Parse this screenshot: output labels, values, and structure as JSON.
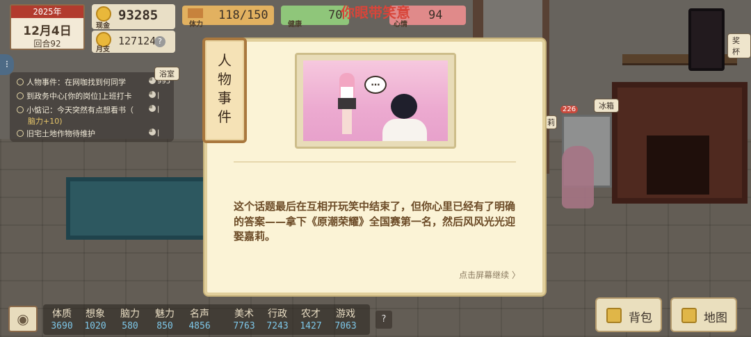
{
  "hud": {
    "year": "2025年",
    "date": "12月4日",
    "turn": "回合92",
    "cash_label": "现金",
    "cash_value": "93285",
    "salary_label": "月支",
    "salary_value": "127124",
    "stamina_label": "体力",
    "stamina_value": "118/150",
    "health_label": "健康",
    "health_value": "70",
    "mood_label": "心情",
    "mood_value": "94",
    "title": "你眼带笑意",
    "qmark": "?"
  },
  "tasks": [
    {
      "text": "人物事件：在网咖找到何同学",
      "progress": "995"
    },
    {
      "text": "到政务中心[你的岗位]上班打卡",
      "progress": "|"
    },
    {
      "text": "小惦记：今天突然有点想看书（",
      "progress": "|"
    },
    {
      "text": "旧宅土地作物待维护",
      "progress": "|"
    }
  ],
  "task_sub": "脑力+10)",
  "room_labels": {
    "bathroom": "浴室",
    "fridge": "冰箱",
    "trophy": "奖杯",
    "partial": "莉",
    "badge": "226"
  },
  "dialog": {
    "tag": "人物事件",
    "story": "这个话题最后在互相开玩笑中结束了，但你心里已经有了明确的答案——拿下《原潮荣耀》全国赛第一名，然后风风光光迎娶嘉莉。",
    "continue": "点击屏幕继续 〉",
    "bubble": "…"
  },
  "stats": [
    {
      "name": "体质",
      "value": "3690"
    },
    {
      "name": "想象",
      "value": "1020"
    },
    {
      "name": "脑力",
      "value": "580"
    },
    {
      "name": "魅力",
      "value": "850"
    },
    {
      "name": "名声",
      "value": "4856"
    },
    {
      "name": "美术",
      "value": "7763"
    },
    {
      "name": "行政",
      "value": "7243"
    },
    {
      "name": "农才",
      "value": "1427"
    },
    {
      "name": "游戏",
      "value": "7063"
    }
  ],
  "buttons": {
    "bag": "背包",
    "map": "地图",
    "help": "?",
    "eye": "◉"
  },
  "colors": {
    "accent_red": "#d8453a",
    "stat_blue": "#7ec7e8",
    "story_brown": "#6b4a26"
  }
}
